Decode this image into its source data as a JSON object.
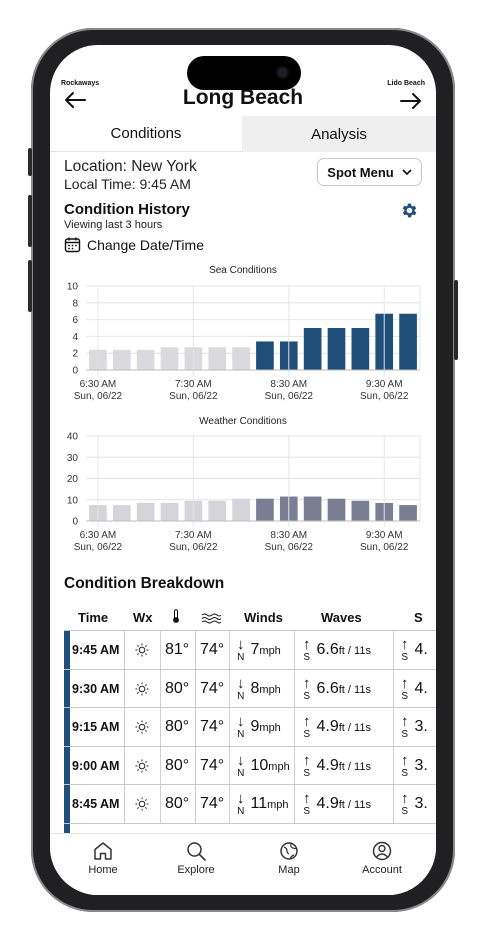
{
  "header": {
    "left_spot": "Rockaways",
    "right_spot": "Lido Beach",
    "title": "Long Beach"
  },
  "tabs": [
    {
      "label": "Conditions",
      "active": true
    },
    {
      "label": "Analysis",
      "active": false
    }
  ],
  "location": {
    "location_label": "Location:",
    "location_value": "New York",
    "time_label": "Local Time:",
    "time_value": "9:45 AM"
  },
  "spot_menu": {
    "label": "Spot Menu"
  },
  "history": {
    "title": "Condition History",
    "subtitle": "Viewing last 3 hours",
    "change_label": "Change Date/Time"
  },
  "colors": {
    "navy": "#1f4e79",
    "sea_past": "#d9d9de",
    "weather_past": "#d4d4da",
    "weather_recent": "#7a7e92"
  },
  "chart_data": [
    {
      "type": "bar",
      "title": "Sea Conditions",
      "ylim": [
        0,
        10
      ],
      "yticks": [
        0,
        2,
        4,
        6,
        8,
        10
      ],
      "x_tick_times": [
        "6:30 AM",
        "7:30 AM",
        "8:30 AM",
        "9:30 AM"
      ],
      "x_tick_dates": [
        "Sun, 06/22",
        "Sun, 06/22",
        "Sun, 06/22",
        "Sun, 06/22"
      ],
      "values": [
        2.4,
        2.4,
        2.4,
        2.7,
        2.7,
        2.7,
        2.7,
        3.4,
        3.4,
        5.0,
        5.0,
        5.0,
        6.7,
        6.7
      ],
      "highlight_from": 7,
      "emphasis_from": 9
    },
    {
      "type": "bar",
      "title": "Weather Conditions",
      "ylim": [
        0,
        40
      ],
      "yticks": [
        0,
        10,
        20,
        30,
        40
      ],
      "x_tick_times": [
        "6:30 AM",
        "7:30 AM",
        "8:30 AM",
        "9:30 AM"
      ],
      "x_tick_dates": [
        "Sun, 06/22",
        "Sun, 06/22",
        "Sun, 06/22",
        "Sun, 06/22"
      ],
      "values": [
        7.5,
        7.5,
        8.5,
        8.5,
        9.5,
        9.5,
        10.5,
        10.5,
        11.5,
        11.5,
        10.5,
        9.5,
        8.5,
        7.5
      ],
      "highlight_from": 7,
      "emphasis_from": 99
    }
  ],
  "breakdown": {
    "title": "Condition Breakdown",
    "headers": {
      "time": "Time",
      "wx": "Wx",
      "winds": "Winds",
      "waves": "Waves",
      "swell": "S"
    },
    "rows": [
      {
        "time": "9:45 AM",
        "air": "81°",
        "water": "74°",
        "wind_dir": "N",
        "wind_speed": "7",
        "wind_unit": "mph",
        "wave_dir": "S",
        "wave_height": "6.6",
        "wave_unit": "ft / 11s",
        "swell_dir": "S",
        "swell_val": "4."
      },
      {
        "time": "9:30 AM",
        "air": "80°",
        "water": "74°",
        "wind_dir": "N",
        "wind_speed": "8",
        "wind_unit": "mph",
        "wave_dir": "S",
        "wave_height": "6.6",
        "wave_unit": "ft / 11s",
        "swell_dir": "S",
        "swell_val": "4."
      },
      {
        "time": "9:15 AM",
        "air": "80°",
        "water": "74°",
        "wind_dir": "N",
        "wind_speed": "9",
        "wind_unit": "mph",
        "wave_dir": "S",
        "wave_height": "4.9",
        "wave_unit": "ft / 11s",
        "swell_dir": "S",
        "swell_val": "3."
      },
      {
        "time": "9:00 AM",
        "air": "80°",
        "water": "74°",
        "wind_dir": "N",
        "wind_speed": "10",
        "wind_unit": "mph",
        "wave_dir": "S",
        "wave_height": "4.9",
        "wave_unit": "ft / 11s",
        "swell_dir": "S",
        "swell_val": "3."
      },
      {
        "time": "8:45 AM",
        "air": "80°",
        "water": "74°",
        "wind_dir": "N",
        "wind_speed": "11",
        "wind_unit": "mph",
        "wave_dir": "S",
        "wave_height": "4.9",
        "wave_unit": "ft / 11s",
        "swell_dir": "S",
        "swell_val": "3."
      }
    ]
  },
  "bottom_nav": [
    {
      "label": "Home",
      "icon": "home-icon"
    },
    {
      "label": "Explore",
      "icon": "search-icon"
    },
    {
      "label": "Map",
      "icon": "map-icon"
    },
    {
      "label": "Account",
      "icon": "account-icon"
    }
  ]
}
